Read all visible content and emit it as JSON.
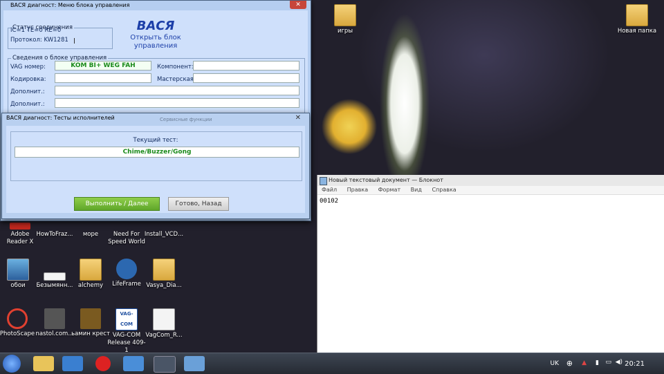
{
  "desktop": {
    "icons": [
      {
        "label": "игры",
        "icon": "folder-icon"
      },
      {
        "label": "Новая папка",
        "icon": "folder-icon"
      },
      {
        "label": "Adobe Reader X",
        "icon": "adobe-reader-icon"
      },
      {
        "label": "HowToFraz...",
        "icon": "shortcut-icon"
      },
      {
        "label": "море",
        "icon": "image-icon"
      },
      {
        "label": "Need For Speed World",
        "icon": "game-icon"
      },
      {
        "label": "Install_VCD...",
        "icon": "installer-icon"
      },
      {
        "label": "обои",
        "icon": "monitor-icon"
      },
      {
        "label": "Безымянн...",
        "icon": "image-icon"
      },
      {
        "label": "alchemy",
        "icon": "folder-icon"
      },
      {
        "label": "LifeFrame",
        "icon": "camera-icon"
      },
      {
        "label": "Vasya_Dia...",
        "icon": "folder-icon"
      },
      {
        "label": "PhotoScape",
        "icon": "photoscape-icon"
      },
      {
        "label": "nastol.com...",
        "icon": "image-icon"
      },
      {
        "label": "ьамин крест",
        "icon": "image-icon"
      },
      {
        "label": "VAG-COM Release 409-1",
        "icon": "vagcom-icon"
      },
      {
        "label": "VagCom_R...",
        "icon": "pdf-icon"
      }
    ]
  },
  "main_window": {
    "title": "ВАСЯ диагност: Меню блока управления",
    "status_legend": "Статус соединения",
    "status_line1": "IC=1  TE=0   RE=0",
    "status_line2": "Протокол: KW1281",
    "brand": "ВАСЯ",
    "open_block_link": "Открыть блок управления",
    "info_legend": "Сведения о блоке управления",
    "vag_label": "VAG номер:",
    "vag_value": "KOM BI+ WEG FAH",
    "component_label": "Компонент:",
    "coding_label": "Кодировка:",
    "workshop_label": "Мастерская",
    "extra1_label": "Дополнит.:",
    "extra2_label": "Дополнит.:",
    "service_ghost": "Сервисные функции"
  },
  "test_dialog": {
    "title": "ВАСЯ диагност: Тесты исполнителей",
    "current_test_label": "Текущий тест:",
    "current_test_value": "Chime/Buzzer/Gong",
    "run_button": "Выполнить / Далее",
    "done_button": "Готово, Назад"
  },
  "notepad": {
    "title": "Новый текстовый документ — Блокнот",
    "menu": [
      "Файл",
      "Правка",
      "Формат",
      "Вид",
      "Справка"
    ],
    "content": "00102"
  },
  "taskbar": {
    "language": "UK",
    "clock": "20:21"
  }
}
